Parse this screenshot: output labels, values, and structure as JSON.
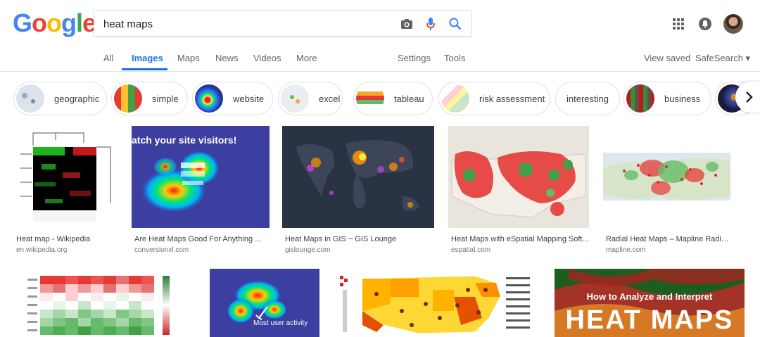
{
  "logo": {
    "letters": [
      "G",
      "o",
      "o",
      "g",
      "l",
      "e"
    ],
    "colors": [
      "#4285f4",
      "#ea4335",
      "#fbbc05",
      "#4285f4",
      "#34a853",
      "#ea4335"
    ]
  },
  "search": {
    "value": "heat maps"
  },
  "tabs": [
    {
      "label": "All"
    },
    {
      "label": "Images"
    },
    {
      "label": "Maps"
    },
    {
      "label": "News"
    },
    {
      "label": "Videos"
    },
    {
      "label": "More"
    },
    {
      "label": "Settings"
    },
    {
      "label": "Tools"
    }
  ],
  "header_right": {
    "view_saved": "View saved",
    "safesearch": "SafeSearch ▾"
  },
  "chips": [
    {
      "label": "geographic"
    },
    {
      "label": "simple"
    },
    {
      "label": "website"
    },
    {
      "label": "excel"
    },
    {
      "label": "tableau"
    },
    {
      "label": "risk assessment"
    },
    {
      "label": "interesting"
    },
    {
      "label": "business"
    }
  ],
  "results_row1": [
    {
      "title": "Heat map - Wikipedia",
      "source": "en.wikipedia.org"
    },
    {
      "title": "Are Heat Maps Good For Anything ...",
      "source": "conversionxl.com",
      "overlay": "atch your site visitors!"
    },
    {
      "title": "Heat Maps in GIS ~ GIS Lounge",
      "source": "gislounge.com"
    },
    {
      "title": "Heat Maps with eSpatial Mapping Soft...",
      "source": "espatial.com"
    },
    {
      "title": "Radial Heat Maps – Mapline Radial ...",
      "source": "mapline.com"
    }
  ],
  "results_row2": [
    {
      "title": ""
    },
    {
      "overlay": "Most user activity"
    },
    {
      "title": ""
    },
    {
      "overlay1": "How to Analyze and Interpret",
      "overlay2": "HEAT MAPS"
    }
  ],
  "colors": {
    "accent": "#1a73e8",
    "text": "#3c4043",
    "muted": "#70757a"
  }
}
